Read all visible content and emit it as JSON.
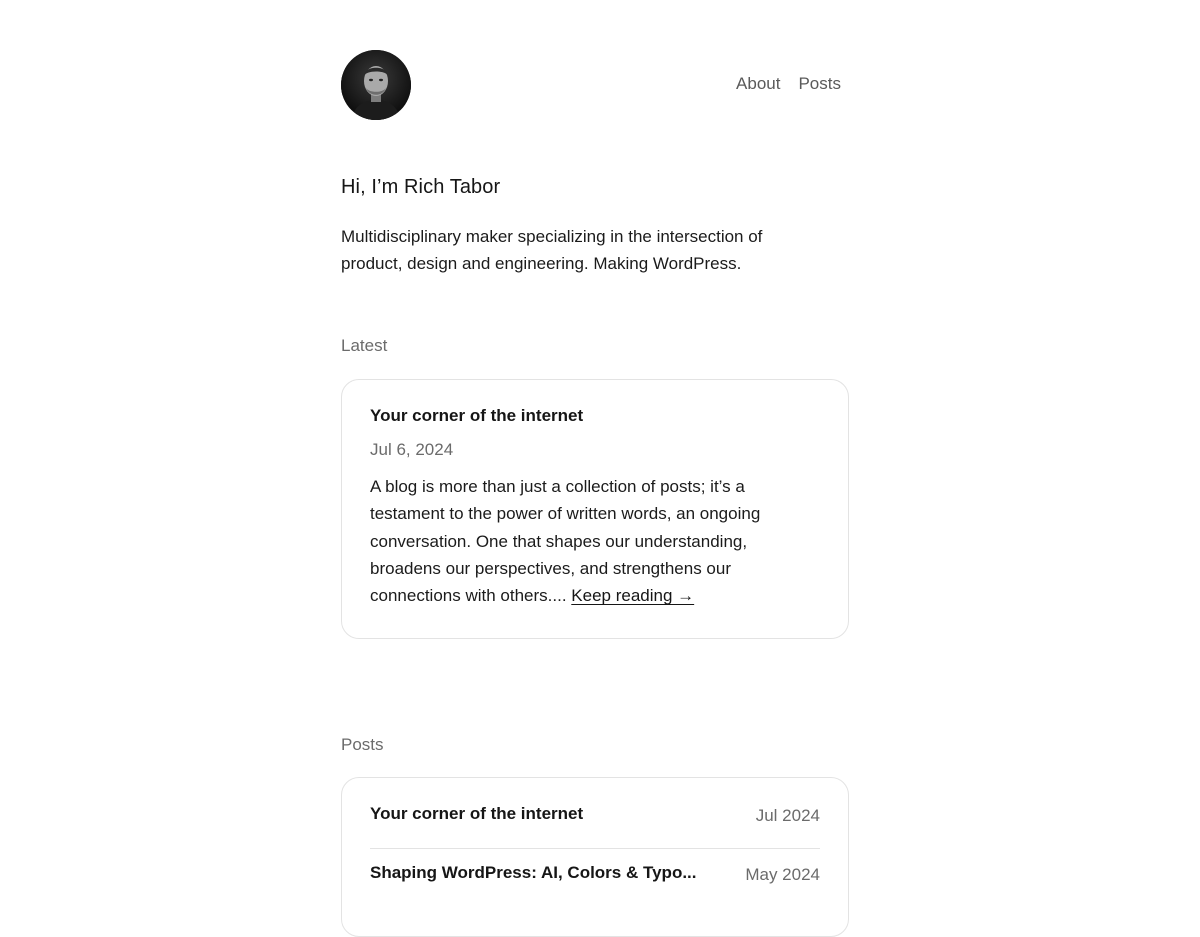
{
  "nav": {
    "about": "About",
    "posts": "Posts"
  },
  "hero": {
    "title": "Hi, I’m Rich Tabor",
    "text": "Multidisciplinary maker specializing in the intersection of product, design and engineering. Making WordPress."
  },
  "latest": {
    "label": "Latest",
    "title": "Your corner of the internet",
    "date": "Jul 6, 2024",
    "excerpt": "A blog is more than just a collection of posts; it’s a testament to the power of written words, an ongoing conversation. One that shapes our understanding, broadens our perspectives, and strengthens our connections with others.... ",
    "read_more": "Keep reading →"
  },
  "posts": {
    "label": "Posts",
    "items": [
      {
        "title": "Your corner of the internet",
        "date": "Jul 2024"
      },
      {
        "title": "Shaping WordPress: AI, Colors & Typo...",
        "date": "May 2024"
      }
    ]
  }
}
